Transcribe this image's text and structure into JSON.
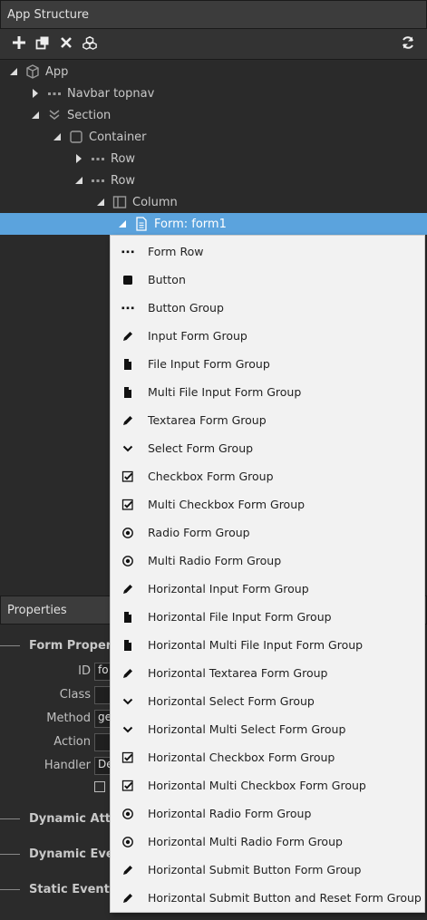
{
  "app_structure": {
    "title": "App Structure",
    "toolbar": {
      "add_icon": "plus-icon",
      "duplicate_icon": "clone-icon",
      "delete_icon": "close-icon",
      "components_icon": "cubes-icon",
      "refresh_icon": "refresh-icon"
    },
    "tree": [
      {
        "label": "App",
        "icon": "cube-icon",
        "expanded": true
      },
      {
        "label": "Navbar topnav",
        "icon": "ellipsis-icon",
        "expanded": false
      },
      {
        "label": "Section",
        "icon": "chevrons-down-icon",
        "expanded": true
      },
      {
        "label": "Container",
        "icon": "square-outline-icon",
        "expanded": true
      },
      {
        "label": "Row",
        "icon": "ellipsis-icon",
        "expanded": false
      },
      {
        "label": "Row",
        "icon": "ellipsis-icon",
        "expanded": true
      },
      {
        "label": "Column",
        "icon": "columns-icon",
        "expanded": true
      },
      {
        "label": "Form: form1",
        "icon": "file-text-icon",
        "expanded": true,
        "selected": true
      }
    ]
  },
  "properties": {
    "title": "Properties",
    "form_properties_title": "Form Propert",
    "id_label": "ID",
    "id_value": "fo",
    "class_label": "Class",
    "class_value": "",
    "method_label": "Method",
    "method_value": "ge",
    "action_label": "Action",
    "action_value": "",
    "handler_label": "Handler",
    "handler_value": "De",
    "dynamic_attributes_title": "Dynamic Attr",
    "dynamic_events_title": "Dynamic Even",
    "static_events_title": "Static Events"
  },
  "context_menu": {
    "items": [
      {
        "label": "Form Row",
        "icon": "ellipsis-icon"
      },
      {
        "label": "Button",
        "icon": "square-icon"
      },
      {
        "label": "Button Group",
        "icon": "ellipsis-icon"
      },
      {
        "label": "Input Form Group",
        "icon": "pencil-icon"
      },
      {
        "label": "File Input Form Group",
        "icon": "file-icon"
      },
      {
        "label": "Multi File Input Form Group",
        "icon": "file-icon"
      },
      {
        "label": "Textarea Form Group",
        "icon": "pencil-icon"
      },
      {
        "label": "Select Form Group",
        "icon": "chevron-down-icon"
      },
      {
        "label": "Checkbox Form Group",
        "icon": "checkbox-icon"
      },
      {
        "label": "Multi Checkbox Form Group",
        "icon": "checkbox-icon"
      },
      {
        "label": "Radio Form Group",
        "icon": "radio-icon"
      },
      {
        "label": "Multi Radio Form Group",
        "icon": "radio-icon"
      },
      {
        "label": "Horizontal Input Form Group",
        "icon": "pencil-icon"
      },
      {
        "label": "Horizontal File Input Form Group",
        "icon": "file-icon"
      },
      {
        "label": "Horizontal Multi File Input Form Group",
        "icon": "file-icon"
      },
      {
        "label": "Horizontal Textarea Form Group",
        "icon": "pencil-icon"
      },
      {
        "label": "Horizontal Select Form Group",
        "icon": "chevron-down-icon"
      },
      {
        "label": "Horizontal Multi Select Form Group",
        "icon": "chevron-down-icon"
      },
      {
        "label": "Horizontal Checkbox Form Group",
        "icon": "checkbox-icon"
      },
      {
        "label": "Horizontal Multi Checkbox Form Group",
        "icon": "checkbox-icon"
      },
      {
        "label": "Horizontal Radio Form Group",
        "icon": "radio-icon"
      },
      {
        "label": "Horizontal Multi Radio Form Group",
        "icon": "radio-icon"
      },
      {
        "label": "Horizontal Submit Button Form Group",
        "icon": "pencil-icon"
      },
      {
        "label": "Horizontal Submit Button and Reset Form Group",
        "icon": "pencil-icon"
      }
    ]
  },
  "colors": {
    "selection": "#5ba3dd",
    "panel_bg": "#2b2b2b",
    "menu_bg": "#f2f2f2"
  }
}
